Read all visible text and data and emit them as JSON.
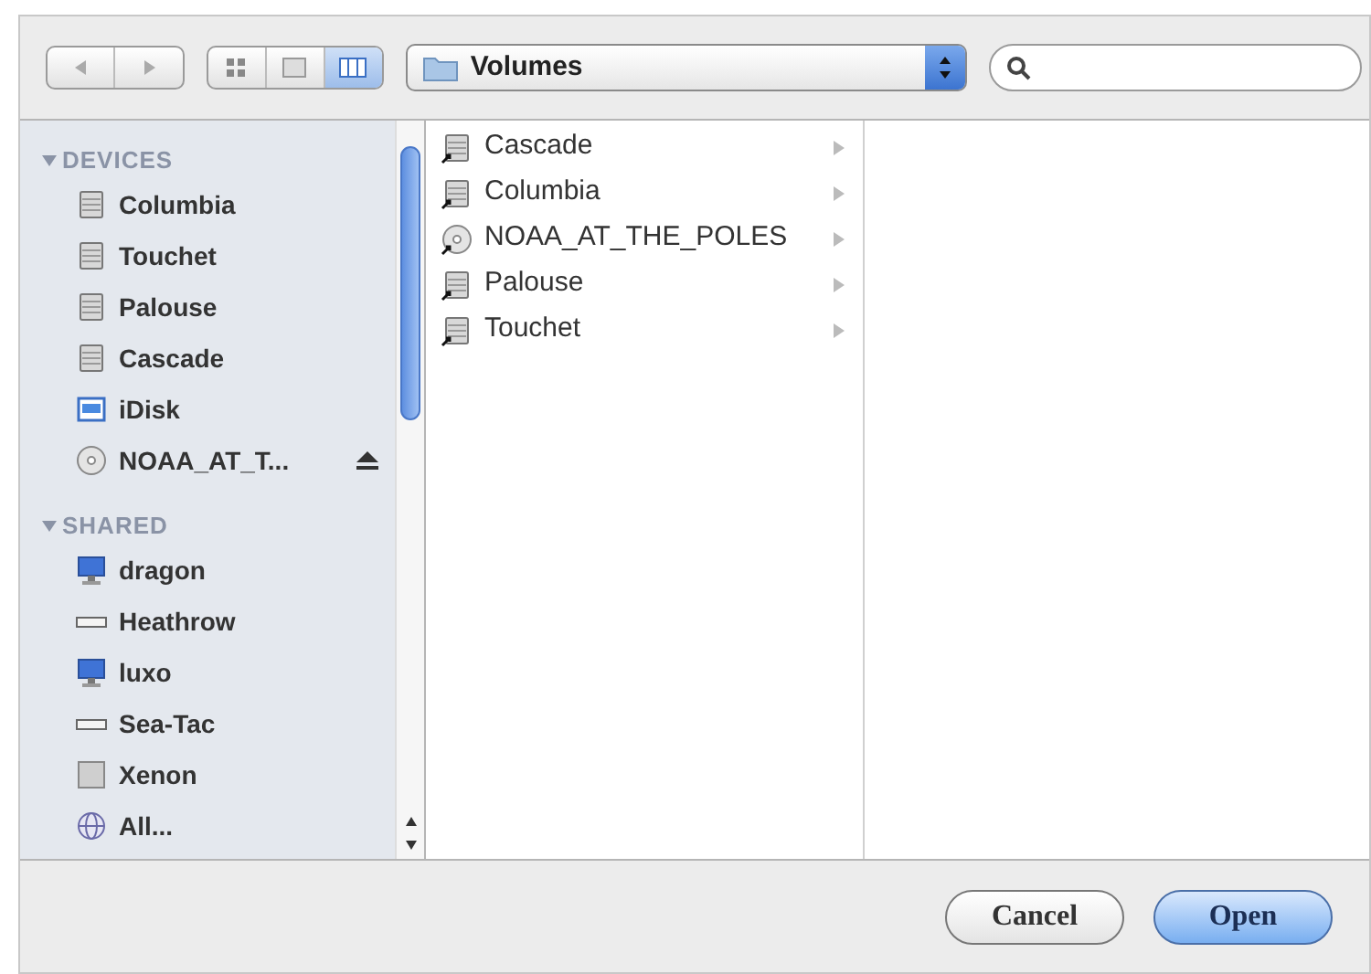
{
  "toolbar": {
    "view_modes": [
      {
        "kind": "icons",
        "selected": false
      },
      {
        "kind": "list",
        "selected": false
      },
      {
        "kind": "columns",
        "selected": true
      }
    ],
    "location": "Volumes"
  },
  "sidebar": {
    "sections": [
      {
        "title": "DEVICES",
        "expanded": true,
        "items": [
          {
            "label": "Columbia",
            "kind": "disk",
            "eject": false
          },
          {
            "label": "Touchet",
            "kind": "disk",
            "eject": false
          },
          {
            "label": "Palouse",
            "kind": "disk",
            "eject": false
          },
          {
            "label": "Cascade",
            "kind": "disk",
            "eject": false
          },
          {
            "label": "iDisk",
            "kind": "idisk",
            "eject": false
          },
          {
            "label": "NOAA_AT_T...",
            "kind": "optical",
            "eject": true
          }
        ]
      },
      {
        "title": "SHARED",
        "expanded": true,
        "items": [
          {
            "label": "dragon",
            "kind": "computer",
            "eject": false
          },
          {
            "label": "Heathrow",
            "kind": "server",
            "eject": false
          },
          {
            "label": "luxo",
            "kind": "computer",
            "eject": false
          },
          {
            "label": "Sea-Tac",
            "kind": "server",
            "eject": false
          },
          {
            "label": "Xenon",
            "kind": "generic",
            "eject": false
          },
          {
            "label": "All...",
            "kind": "network",
            "eject": false
          }
        ]
      }
    ]
  },
  "columns": [
    {
      "items": [
        {
          "label": "Cascade",
          "kind": "disk",
          "selected": false
        },
        {
          "label": "Columbia",
          "kind": "disk",
          "selected": false
        },
        {
          "label": "NOAA_AT_THE_POLES",
          "kind": "optical",
          "selected": false
        },
        {
          "label": "Palouse",
          "kind": "disk",
          "selected": false
        },
        {
          "label": "Touchet",
          "kind": "disk",
          "selected": false
        }
      ]
    }
  ],
  "buttons": [
    {
      "label": "Cancel",
      "kind": "normal"
    },
    {
      "label": "Open",
      "kind": "default"
    }
  ]
}
